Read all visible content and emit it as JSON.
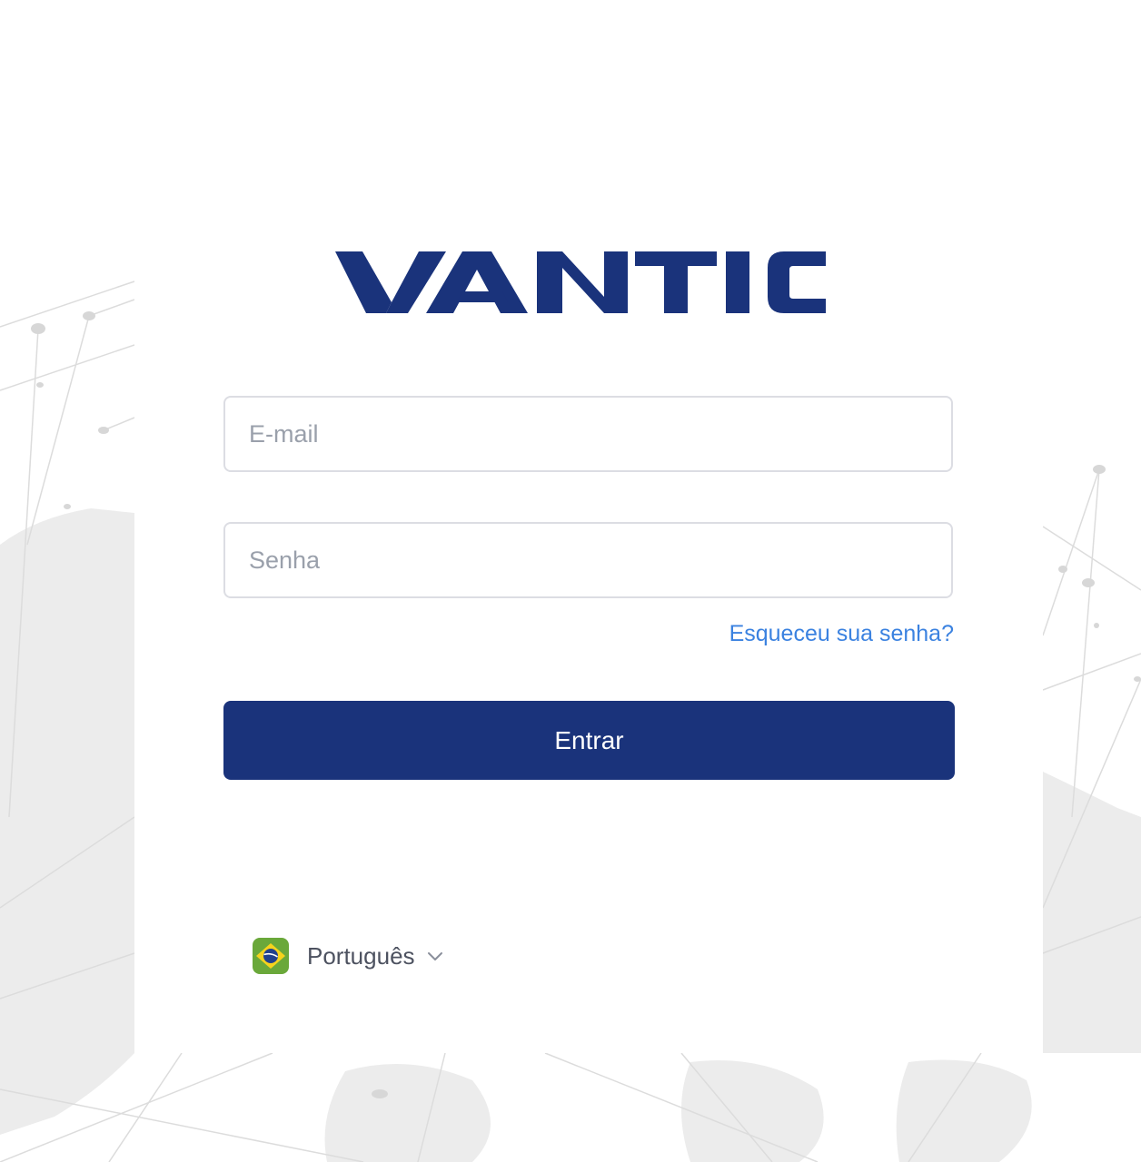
{
  "brand": {
    "name": "VANTICO",
    "color": "#1a337b"
  },
  "login": {
    "email_placeholder": "E-mail",
    "password_placeholder": "Senha",
    "forgot_label": "Esqueceu sua senha?",
    "submit_label": "Entrar"
  },
  "language": {
    "selected": "Português",
    "flag_icon": "brazil-flag-icon",
    "chevron_icon": "chevron-down-icon"
  },
  "colors": {
    "primary": "#1a337b",
    "link": "#3b82e0",
    "background": "#ffffff"
  }
}
